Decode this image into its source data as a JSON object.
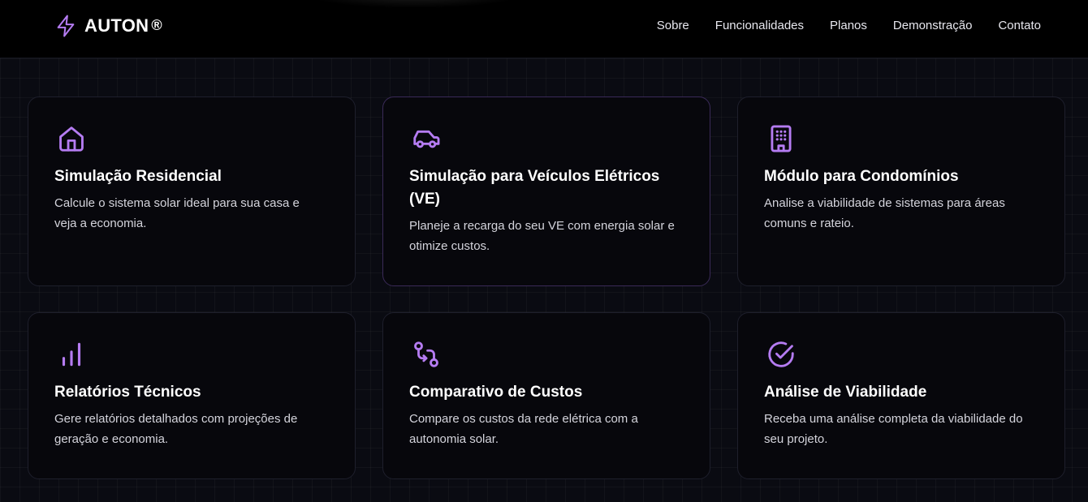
{
  "brand": {
    "name": "AUTON",
    "mark": "®",
    "icon": "lightning-bolt-icon"
  },
  "nav": {
    "links": [
      "Sobre",
      "Funcionalidades",
      "Planos",
      "Demonstração",
      "Contato"
    ]
  },
  "colors": {
    "accent": "#b57cf2",
    "background": "#0a0b12",
    "card": "#07070c",
    "card_border": "#1e1f2c",
    "card_border_highlight": "#3a2a58"
  },
  "features": [
    {
      "icon": "house-icon",
      "title": "Simulação Residencial",
      "description": "Calcule o sistema solar ideal para sua casa e veja a economia."
    },
    {
      "icon": "car-icon",
      "title": "Simulação para Veículos Elétricos (VE)",
      "description": "Planeje a recarga do seu VE com energia solar e otimize custos."
    },
    {
      "icon": "building-icon",
      "title": "Módulo para Condomínios",
      "description": "Analise a viabilidade de sistemas para áreas comuns e rateio."
    },
    {
      "icon": "bar-chart-icon",
      "title": "Relatórios Técnicos",
      "description": "Gere relatórios detalhados com projeções de geração e economia."
    },
    {
      "icon": "git-compare-icon",
      "title": "Comparativo de Custos",
      "description": "Compare os custos da rede elétrica com a autonomia solar."
    },
    {
      "icon": "check-circle-icon",
      "title": "Análise de Viabilidade",
      "description": "Receba uma análise completa da viabilidade do seu projeto."
    }
  ]
}
